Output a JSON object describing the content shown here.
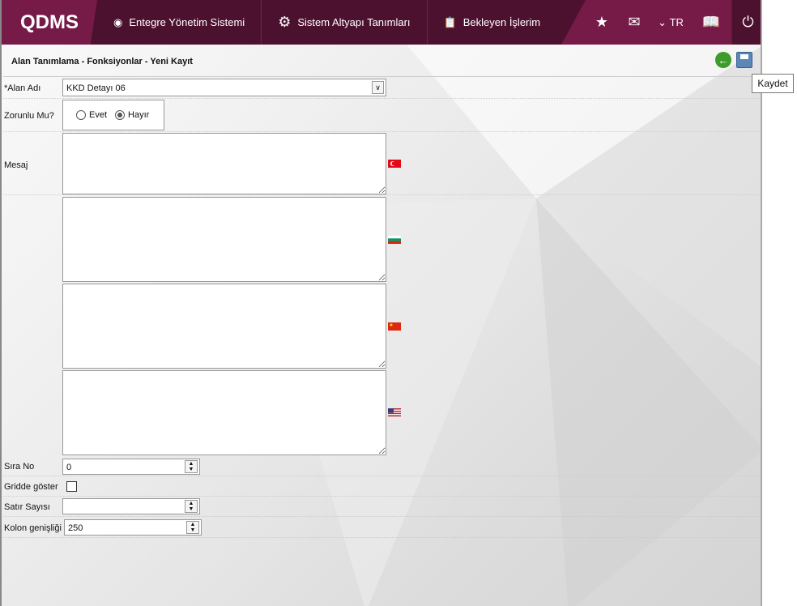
{
  "header": {
    "logo": "QDMS",
    "nav": [
      {
        "label": "Entegre Yönetim Sistemi",
        "icon": "q-logo-icon"
      },
      {
        "label": "Sistem Altyapı Tanımları",
        "icon": "gear-icon"
      },
      {
        "label": "Bekleyen İşlerim",
        "icon": "clipboard-icon"
      }
    ],
    "language": "TR"
  },
  "page": {
    "title": "Alan Tanımlama - Fonksiyonlar - Yeni Kayıt",
    "tooltip": "Kaydet"
  },
  "form": {
    "alan_adi": {
      "label": "*Alan Adı",
      "value": "KKD Detayı  06"
    },
    "zorunlu": {
      "label": "Zorunlu Mu?",
      "options": [
        "Evet",
        "Hayır"
      ],
      "selected": "Hayır"
    },
    "mesaj": {
      "label": "Mesaj",
      "languages": [
        "tr",
        "bg",
        "cn",
        "us"
      ],
      "values": [
        "",
        "",
        "",
        ""
      ]
    },
    "sira_no": {
      "label": "Sıra No",
      "value": "0"
    },
    "gridde": {
      "label": "Gridde göster",
      "checked": false
    },
    "satir": {
      "label": "Satır Sayısı",
      "value": ""
    },
    "kolon": {
      "label": "Kolon genişliği",
      "value": "250"
    }
  }
}
